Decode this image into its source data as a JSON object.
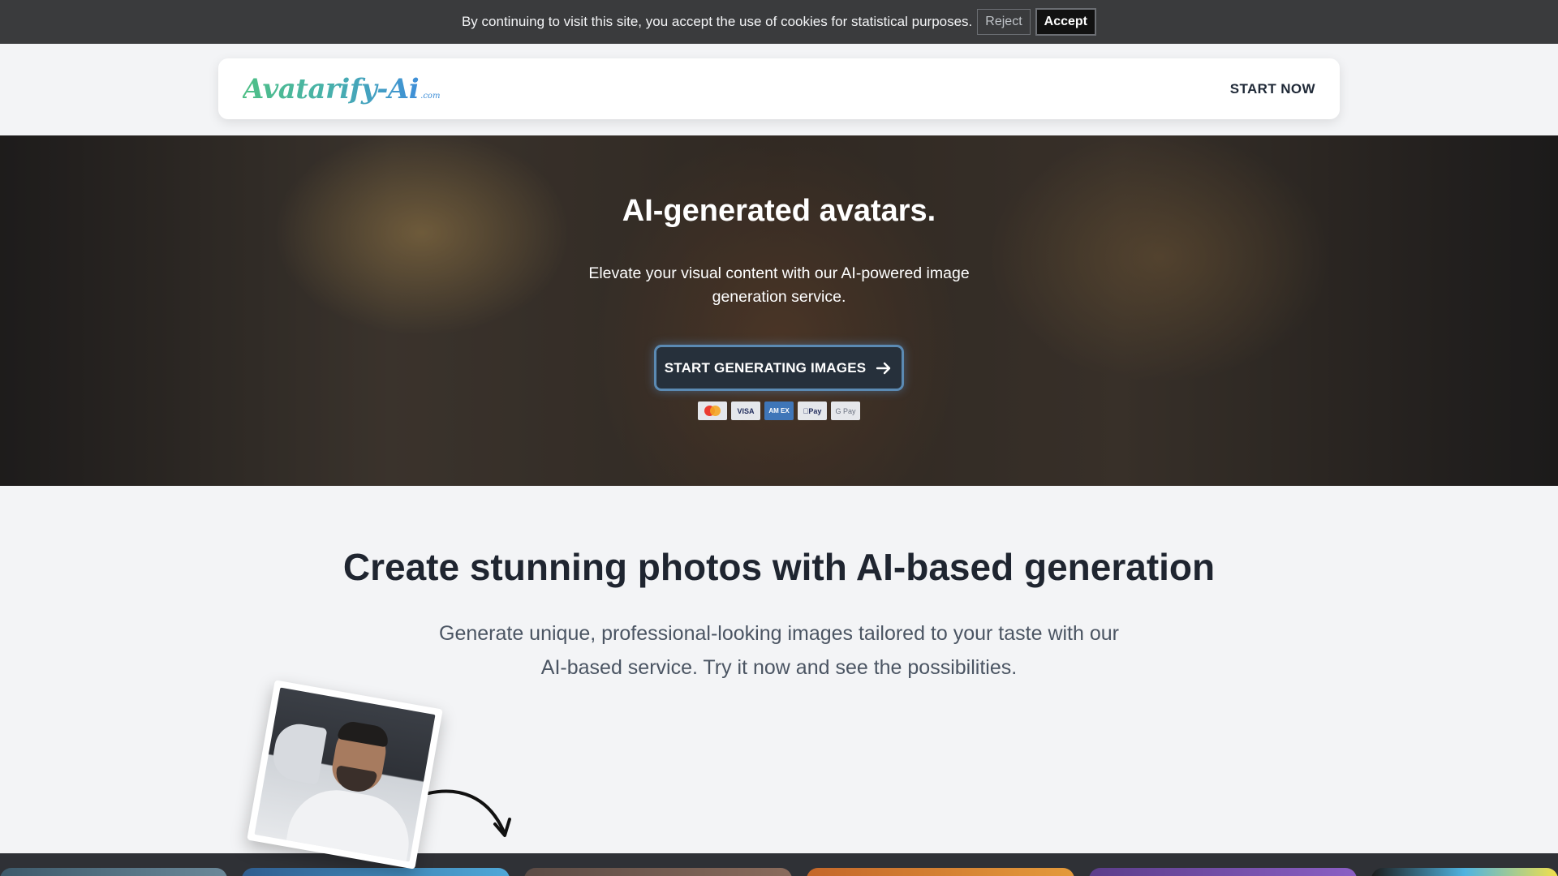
{
  "cookie_bar": {
    "message": "By continuing to visit this site, you accept the use of cookies for statistical purposes.",
    "reject_label": "Reject",
    "accept_label": "Accept"
  },
  "header": {
    "logo_text": "Avatarify-Ai",
    "logo_suffix": ".com",
    "nav_label": "START NOW"
  },
  "hero": {
    "title": "AI-generated avatars.",
    "subtitle": "Elevate your visual content with our AI-powered image generation service.",
    "cta_label": "START GENERATING IMAGES",
    "payment_methods": [
      {
        "name": "mastercard-icon",
        "label": ""
      },
      {
        "name": "visa-icon",
        "label": "VISA"
      },
      {
        "name": "amex-icon",
        "label": "AM EX"
      },
      {
        "name": "apple-pay-icon",
        "label": "Pay"
      },
      {
        "name": "google-pay-icon",
        "label": "G Pay"
      }
    ]
  },
  "section": {
    "title": "Create stunning photos with AI-based generation",
    "subtitle": "Generate unique, professional-looking images tailored to your taste with our AI-based service. Try it now and see the possibilities."
  },
  "colors": {
    "cookie_bg": "#3a3b3d",
    "cta_border": "#5b8ab3",
    "logo_green": "#4fbf86",
    "logo_blue": "#3f8fd8"
  }
}
